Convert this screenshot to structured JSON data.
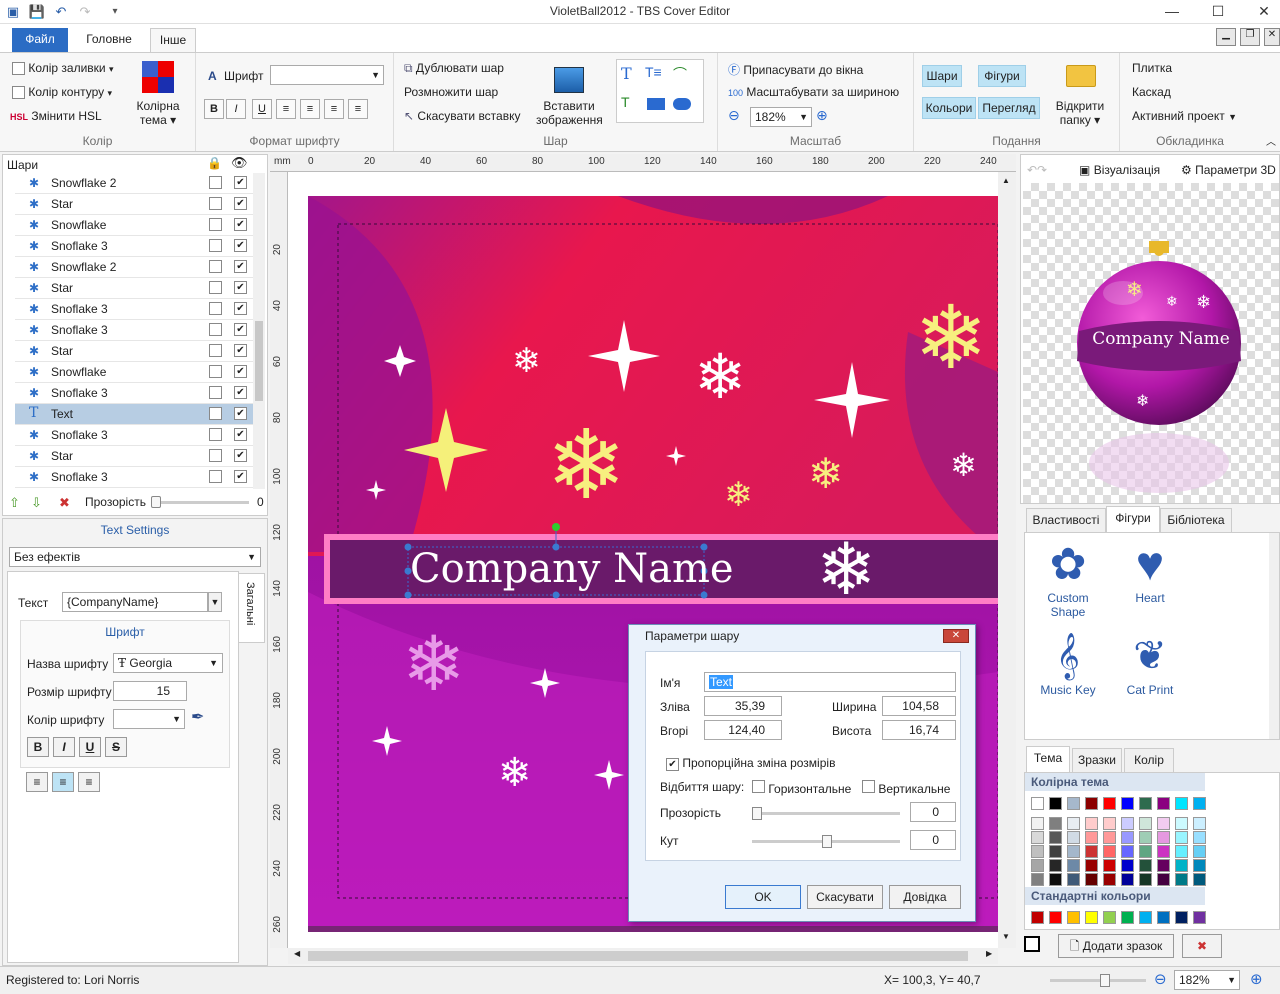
{
  "window": {
    "title": "VioletBall2012 - TBS Cover Editor"
  },
  "ribbon_tabs": [
    "Файл",
    "Головне",
    "Інше"
  ],
  "ribbon": {
    "color_group": {
      "fill_color": "Колір заливки",
      "outline_color": "Колір контуру",
      "hsl": "Змінити HSL",
      "hsl_icon": "HSL",
      "color_theme_line1": "Колірна",
      "color_theme_line2": "тема",
      "label": "Колір"
    },
    "font_group": {
      "font_label": "Шрифт",
      "font_value": "",
      "label": "Формат шрифту",
      "bold": "B",
      "italic": "I",
      "underline": "U"
    },
    "layer_group": {
      "duplicate": "Дублювати шар",
      "multiply": "Розмножити шар",
      "cancel_paste": "Скасувати вставку",
      "insert_image_line1": "Вставити",
      "insert_image_line2": "зображення",
      "label": "Шар"
    },
    "scale_group": {
      "fit_window": "Припасувати до вікна",
      "fit_width": "Масштабувати за шириною",
      "zoom": "182%",
      "label": "Масштаб"
    },
    "view_group": {
      "layers": "Шари",
      "shapes": "Фігури",
      "colors": "Кольори",
      "preview": "Перегляд",
      "open_folder_line1": "Відкрити",
      "open_folder_line2": "папку",
      "label": "Подання"
    },
    "cover_group": {
      "tile": "Плитка",
      "cascade": "Каскад",
      "active_project": "Активний проект",
      "label": "Обкладинка"
    }
  },
  "layers_panel": {
    "title": "Шари",
    "items": [
      {
        "name": "Snowflake 2",
        "icon": "puzzle-icon",
        "locked": false,
        "visible": true,
        "selected": false
      },
      {
        "name": "Star",
        "icon": "puzzle-icon",
        "locked": false,
        "visible": true,
        "selected": false
      },
      {
        "name": "Snowflake",
        "icon": "puzzle-icon",
        "locked": false,
        "visible": true,
        "selected": false
      },
      {
        "name": "Snoflake 3",
        "icon": "puzzle-icon",
        "locked": false,
        "visible": true,
        "selected": false
      },
      {
        "name": "Snowflake 2",
        "icon": "puzzle-icon",
        "locked": false,
        "visible": true,
        "selected": false
      },
      {
        "name": "Star",
        "icon": "puzzle-icon",
        "locked": false,
        "visible": true,
        "selected": false
      },
      {
        "name": "Snoflake 3",
        "icon": "puzzle-icon",
        "locked": false,
        "visible": true,
        "selected": false
      },
      {
        "name": "Snoflake 3",
        "icon": "puzzle-icon",
        "locked": false,
        "visible": true,
        "selected": false
      },
      {
        "name": "Star",
        "icon": "puzzle-icon",
        "locked": false,
        "visible": true,
        "selected": false
      },
      {
        "name": "Snowflake",
        "icon": "puzzle-icon",
        "locked": false,
        "visible": true,
        "selected": false
      },
      {
        "name": "Snoflake 3",
        "icon": "puzzle-icon",
        "locked": false,
        "visible": true,
        "selected": false
      },
      {
        "name": "Text",
        "icon": "text-icon",
        "locked": false,
        "visible": true,
        "selected": true
      },
      {
        "name": "Snoflake 3",
        "icon": "puzzle-icon",
        "locked": false,
        "visible": true,
        "selected": false
      },
      {
        "name": "Star",
        "icon": "puzzle-icon",
        "locked": false,
        "visible": true,
        "selected": false
      },
      {
        "name": "Snoflake 3",
        "icon": "puzzle-icon",
        "locked": false,
        "visible": true,
        "selected": false
      }
    ],
    "opacity_label": "Прозорість",
    "opacity_value": "0"
  },
  "text_settings": {
    "title": "Text Settings",
    "effects": "Без ефектів",
    "side_tab": "Загальні",
    "text_label": "Текст",
    "text_value": "{CompanyName}",
    "font_section": "Шрифт",
    "font_name_label": "Назва шрифту",
    "font_name_value": "Georgia",
    "font_size_label": "Розмір шрифту",
    "font_size_value": "15",
    "font_color_label": "Колір шрифту",
    "bold": "B",
    "italic": "I",
    "underline": "U",
    "strike": "S"
  },
  "canvas": {
    "company_text": "Company Name",
    "ruler_top": [
      "mm",
      "0",
      "20",
      "40",
      "60",
      "80",
      "100",
      "120",
      "140",
      "160",
      "180",
      "200",
      "220",
      "240"
    ],
    "ruler_left": [
      "20",
      "40",
      "60",
      "80",
      "100",
      "120",
      "140",
      "160",
      "180",
      "200",
      "220",
      "240",
      "260"
    ]
  },
  "dialog": {
    "title": "Параметри шару",
    "name_label": "Ім'я",
    "name_value": "Text",
    "left_label": "Зліва",
    "left_value": "35,39",
    "top_label": "Вгорі",
    "top_value": "124,40",
    "width_label": "Ширина",
    "width_value": "104,58",
    "height_label": "Висота",
    "height_value": "16,74",
    "proportional": "Пропорційна зміна розмірів",
    "proportional_checked": true,
    "mirror_label": "Відбиття шару:",
    "horizontal": "Горизонтальне",
    "vertical": "Вертикальне",
    "opacity_label": "Прозорість",
    "opacity_value": "0",
    "angle_label": "Кут",
    "angle_value": "0",
    "ok": "OK",
    "cancel": "Скасувати",
    "help": "Довідка"
  },
  "preview_panel": {
    "visualize": "Візуалізація",
    "params3d": "Параметри 3D",
    "ball_text": "Company Name"
  },
  "shapes_panel": {
    "tabs": [
      "Властивості",
      "Фігури",
      "Бібліотека"
    ],
    "active_tab": "Фігури",
    "shapes": [
      {
        "name": "Custom Shape",
        "icon": "puzzle-shape-icon"
      },
      {
        "name": "Heart",
        "icon": "heart-icon"
      },
      {
        "name": "Music Key",
        "icon": "treble-clef-icon"
      },
      {
        "name": "Cat Print",
        "icon": "paw-icon"
      }
    ]
  },
  "colors_panel": {
    "tabs": [
      "Тема",
      "Зразки",
      "Колір"
    ],
    "active_tab": "Тема",
    "theme_title": "Колірна тема",
    "standard_title": "Стандартні кольори",
    "add_sample": "Додати зразок",
    "theme_top": [
      "#ffffff",
      "#000000",
      "#a6b8cc",
      "#8b0000",
      "#ff0000",
      "#0000ff",
      "#2e6b4e",
      "#8b0080",
      "#00e5ff",
      "#00b0f0"
    ],
    "theme_shades": [
      [
        "#f2f2f2",
        "#d9d9d9",
        "#bfbfbf",
        "#a6a6a6",
        "#808080"
      ],
      [
        "#7f7f7f",
        "#595959",
        "#404040",
        "#262626",
        "#0d0d0d"
      ],
      [
        "#e8edf2",
        "#d1dbe5",
        "#a4b7cb",
        "#6d89a7",
        "#3f5a78"
      ],
      [
        "#ffcccc",
        "#ff9999",
        "#cc3333",
        "#990000",
        "#660000"
      ],
      [
        "#ffcccc",
        "#ff9999",
        "#ff6666",
        "#cc0000",
        "#990000"
      ],
      [
        "#ccccff",
        "#9999ff",
        "#6666ff",
        "#0000cc",
        "#000099"
      ],
      [
        "#cfe6da",
        "#9fcdb5",
        "#5fa683",
        "#23513a",
        "#163626"
      ],
      [
        "#f2ccf0",
        "#e599e0",
        "#cc33c2",
        "#66005f",
        "#440040"
      ],
      [
        "#ccfaff",
        "#99f5ff",
        "#66efff",
        "#00b3c7",
        "#007a88"
      ],
      [
        "#ccefff",
        "#99dfff",
        "#66cff5",
        "#0088bb",
        "#005a7d"
      ]
    ],
    "standard": [
      "#c00000",
      "#ff0000",
      "#ffc000",
      "#ffff00",
      "#92d050",
      "#00b050",
      "#00b0f0",
      "#0070c0",
      "#002060",
      "#7030a0"
    ]
  },
  "status": {
    "registered": "Registered to: Lori Norris",
    "coords": "X= 100,3, Y=  40,7",
    "zoom": "182%"
  }
}
